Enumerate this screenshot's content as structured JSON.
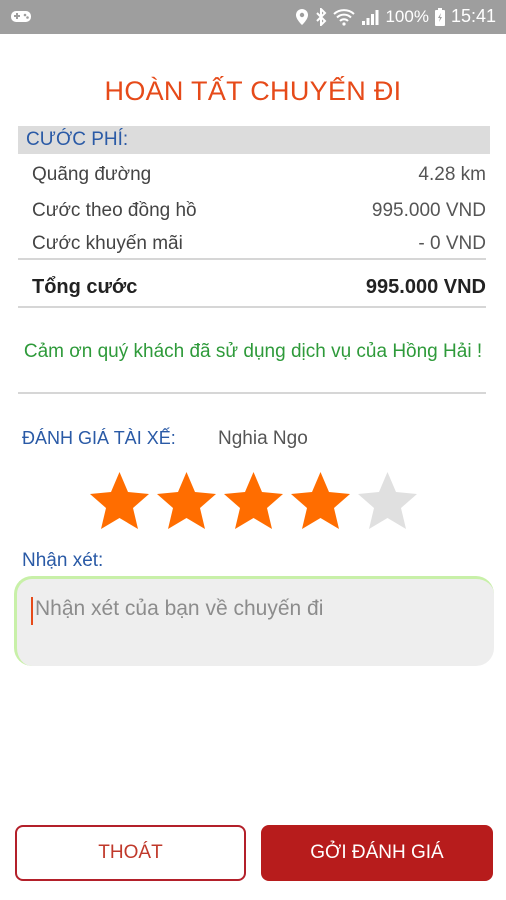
{
  "status_bar": {
    "battery_text": "100%",
    "time": "15:41"
  },
  "title": "HOÀN TẤT CHUYẾN ĐI",
  "fees": {
    "header": "CƯỚC PHÍ:",
    "rows": [
      {
        "label": "Quãng đường",
        "value": "4.28 km"
      },
      {
        "label": "Cước theo đồng hồ",
        "value": "995.000 VND"
      },
      {
        "label": "Cước khuyến mãi",
        "value": "- 0 VND"
      }
    ],
    "total": {
      "label": "Tổng cước",
      "value": "995.000 VND"
    }
  },
  "thanks_message": "Cảm ơn quý khách đã sử dụng dịch vụ của Hồng Hải !",
  "rating": {
    "label": "ĐÁNH GIÁ TÀI XẾ:",
    "driver_name": "Nghia Ngo",
    "value": 4,
    "max": 5,
    "filled_color": "#ff6d00",
    "empty_color": "#e0e0e0"
  },
  "comment": {
    "label": "Nhận xét:",
    "placeholder": "Nhận xét của bạn về chuyến đi",
    "value": ""
  },
  "buttons": {
    "exit": "THOÁT",
    "submit": "GỞI ĐÁNH GIÁ"
  },
  "colors": {
    "title": "#e64a19",
    "accent_blue": "#2a5aa6",
    "thanks_green": "#2e9a3a",
    "primary_red": "#b71c1c"
  }
}
